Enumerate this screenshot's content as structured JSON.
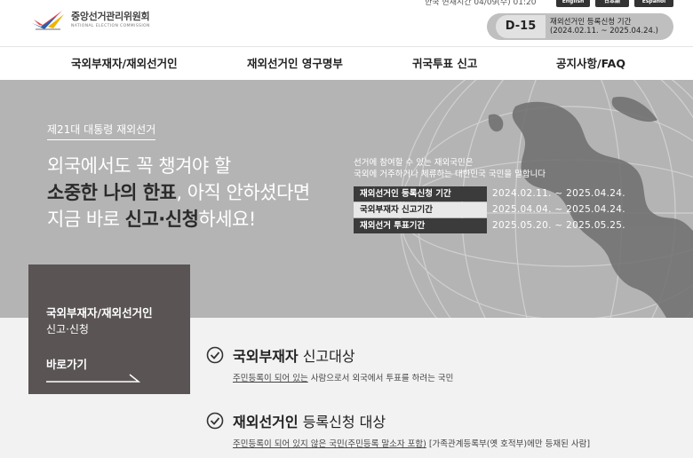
{
  "header": {
    "logo_text_kor": "중앙선거관리위원회",
    "logo_text_eng": "NATIONAL ELECTION COMMISSION",
    "local_time": "한국 현재시간 04/09(수) 01:20",
    "languages": [
      "English",
      "日本語",
      "Español"
    ],
    "dday": {
      "label": "D-15",
      "line1": "재외선거인 등록신청 기간",
      "line2": "(2024.02.11. ~ 2025.04.24.)"
    }
  },
  "nav": {
    "items": [
      "국외부재자/재외선거인",
      "재외선거인 영구명부",
      "귀국투표 신고",
      "공지사항/FAQ"
    ]
  },
  "hero": {
    "tag": "제21대 대통령 재외선거",
    "line1": "외국에서도 꼭 챙겨야 할",
    "line2_bold": "소중한 나의 한표",
    "line2_rest": ", 아직 안하셨다면",
    "line3_pre": "지금 바로 ",
    "line3_bold": "신고·신청",
    "line3_post": "하세요!",
    "eligibility_line1": "선거에 참여할 수 있는 재외국민은",
    "eligibility_line2": "국외에 거주하거나 체류하는 대한민국 국민을 말합니다",
    "periods": [
      {
        "label": "재외선거인 등록신청 기간",
        "value": "2024.02.11. ~ 2025.04.24."
      },
      {
        "label": "국외부재자 신고기간",
        "value": "2025.04.04. ~ 2025.04.24."
      },
      {
        "label": "재외선거 투표기간",
        "value": "2025.05.20. ~ 2025.05.25."
      }
    ]
  },
  "card": {
    "title": "국외부재자/재외선거인",
    "subtitle": "신고·신청",
    "go": "바로가기"
  },
  "targets": [
    {
      "title_bold": "국외부재자",
      "title_rest": " 신고대상",
      "desc_underlined": "주민등록이 되어 있는",
      "desc_rest": " 사람으로서 외국에서 투표를 하려는 국민"
    },
    {
      "title_bold": "재외선거인",
      "title_rest": " 등록신청 대상",
      "desc_underlined": "주민등록이 되어 있지 않은 국민(주민등록 말소자 포함)",
      "desc_rest": " [가족관계등록부(옛 호적부)에만 등재된 사람]"
    }
  ]
}
